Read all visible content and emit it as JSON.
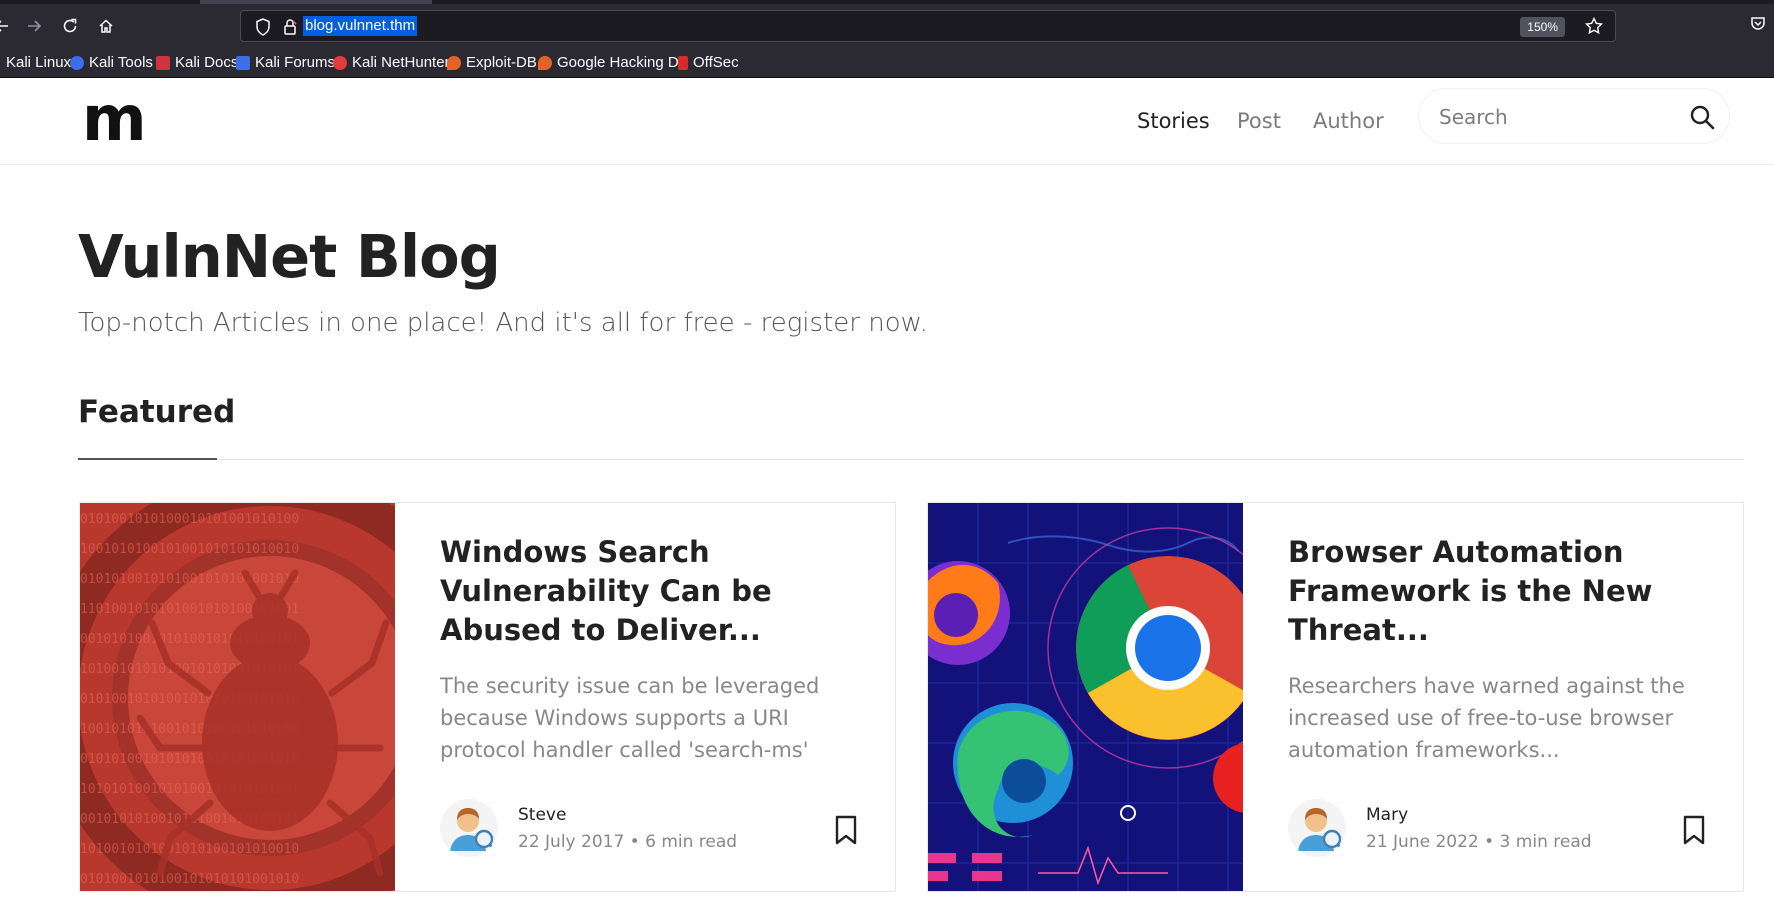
{
  "browser": {
    "url": "blog.vulnnet.thm",
    "zoom": "150%",
    "bookmarks": [
      {
        "label": "Kali Linux",
        "color": "#367bf0"
      },
      {
        "label": "Kali Tools",
        "color": "#3a6fe6"
      },
      {
        "label": "Kali Docs",
        "color": "#d0343a"
      },
      {
        "label": "Kali Forums",
        "color": "#3a6fe6"
      },
      {
        "label": "Kali NetHunter",
        "color": "#e43c3c"
      },
      {
        "label": "Exploit-DB",
        "color": "#e3622a"
      },
      {
        "label": "Google Hacking DB",
        "color": "#e3622a"
      },
      {
        "label": "OffSec",
        "color": "#d62c2c"
      }
    ]
  },
  "header": {
    "logo": "m",
    "nav": [
      "Stories",
      "Post",
      "Author"
    ],
    "search_placeholder": "Search"
  },
  "hero": {
    "title": "VulnNet Blog",
    "subtitle": "Top-notch Articles in one place! And it's all for free - register now."
  },
  "section": {
    "title": "Featured"
  },
  "cards": [
    {
      "title": "Windows Search Vulnerability Can be Abused to Deliver...",
      "excerpt": "The security issue can be leveraged because Windows supports a URI protocol handler called 'search-ms'",
      "author": "Steve",
      "meta": "22 July 2017 • 6 min read"
    },
    {
      "title": "Browser Automation Framework is the New Threat...",
      "excerpt": "Researchers have warned against the increased use of free-to-use browser automation frameworks...",
      "author": "Mary",
      "meta": "21 June 2022 • 3 min read"
    }
  ]
}
